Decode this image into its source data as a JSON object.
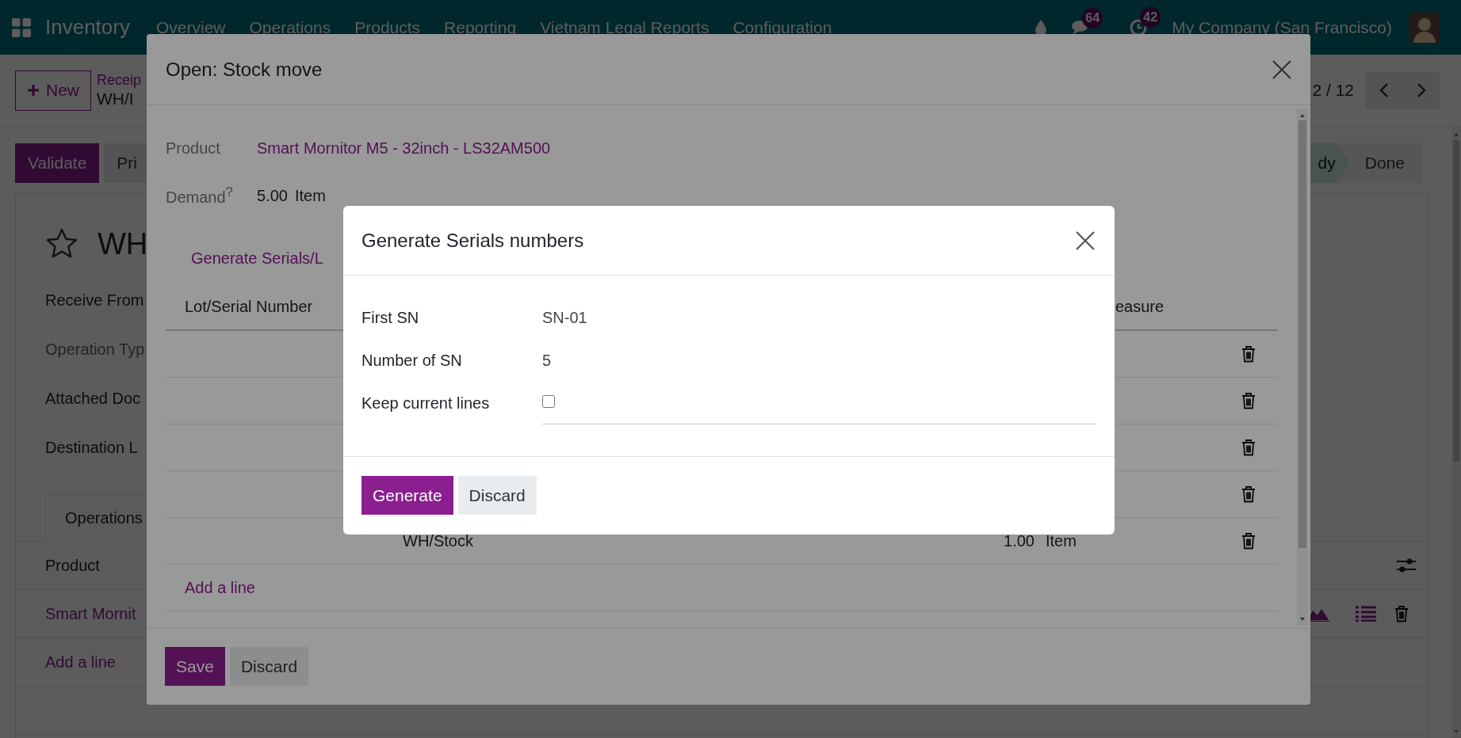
{
  "navbar": {
    "app": "Inventory",
    "menus": [
      "Overview",
      "Operations",
      "Products",
      "Reporting",
      "Vietnam Legal Reports",
      "Configuration"
    ],
    "systray": [
      {
        "kind": "drop"
      },
      {
        "kind": "chat",
        "badge": "64"
      },
      {
        "kind": "activity",
        "badge": "42"
      }
    ],
    "company": "My Company (San Francisco)"
  },
  "control_panel": {
    "new_button": "New",
    "breadcrumb": "Receip",
    "record": "WH/I",
    "pager": "2 / 12"
  },
  "form": {
    "buttons": [
      {
        "label": "Validate",
        "primary": true
      },
      {
        "label": "Pri",
        "primary": false
      }
    ],
    "stages": [
      {
        "label": "dy",
        "selected": true
      },
      {
        "label": "Done",
        "selected": false
      }
    ],
    "starred": false,
    "title": "WH",
    "fields": [
      {
        "label": "Receive From",
        "disabled": false
      },
      {
        "label": "Operation Typ",
        "disabled": true
      },
      {
        "label": "Attached Doc",
        "disabled": false
      },
      {
        "label": "Destination L",
        "disabled": false
      }
    ],
    "tabs": [
      {
        "label": "Operations",
        "selected": true
      }
    ],
    "table": {
      "header": "Product",
      "rows": [
        {
          "product": "Smart Mornit"
        }
      ],
      "add_line": "Add a line"
    }
  },
  "stock_move_dialog": {
    "title": "Open: Stock move",
    "fields": [
      {
        "kind": "link",
        "label": "Product",
        "value": "Smart Mornitor M5 - 32inch - LS32AM500"
      },
      {
        "kind": "quantity",
        "label": "Demand$^{?}$",
        "value": "5.00",
        "unit": "Item"
      }
    ],
    "generate_link": "Generate Serials/L",
    "columns": [
      "Lot/Serial Number",
      "easure"
    ],
    "rows": [
      {
        "kind": "covered"
      },
      {
        "kind": "covered"
      },
      {
        "kind": "covered"
      },
      {
        "kind": "covered"
      },
      {
        "kind": "line",
        "location": "WH/Stock",
        "quantity": "1.00",
        "unit": "Item"
      }
    ],
    "add_line": "Add a line",
    "buttons": [
      {
        "label": "Save",
        "primary": true
      },
      {
        "label": "Discard",
        "primary": false
      }
    ]
  },
  "generate_dialog": {
    "title": "Generate Serials numbers",
    "fields": [
      {
        "kind": "text",
        "label": "First SN",
        "value": "SN-01"
      },
      {
        "kind": "text",
        "label": "Number of SN",
        "value": "5"
      },
      {
        "kind": "checkbox",
        "label": "Keep current lines",
        "checked": false
      }
    ],
    "buttons": [
      {
        "label": "Generate",
        "primary": true
      },
      {
        "label": "Discard",
        "primary": false
      }
    ]
  }
}
